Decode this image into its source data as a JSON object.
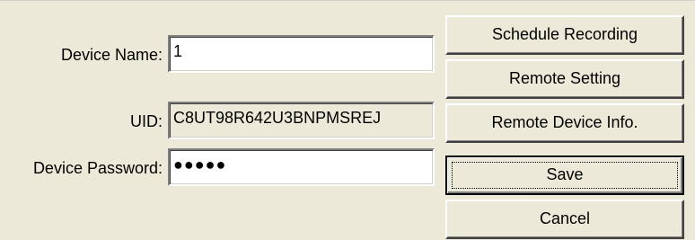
{
  "form": {
    "device_name_label": "Device Name:",
    "device_name_value": "1",
    "uid_label": "UID:",
    "uid_value": "C8UT98R642U3BNPMSREJ",
    "device_password_label": "Device Password:",
    "device_password_value": "●●●●●"
  },
  "buttons": {
    "schedule_recording": "Schedule Recording",
    "remote_setting": "Remote Setting",
    "remote_device_info": "Remote Device Info.",
    "save": "Save",
    "cancel": "Cancel"
  },
  "colors": {
    "dialog_background": "#ECE9D8",
    "field_background": "#FFFFFF"
  }
}
